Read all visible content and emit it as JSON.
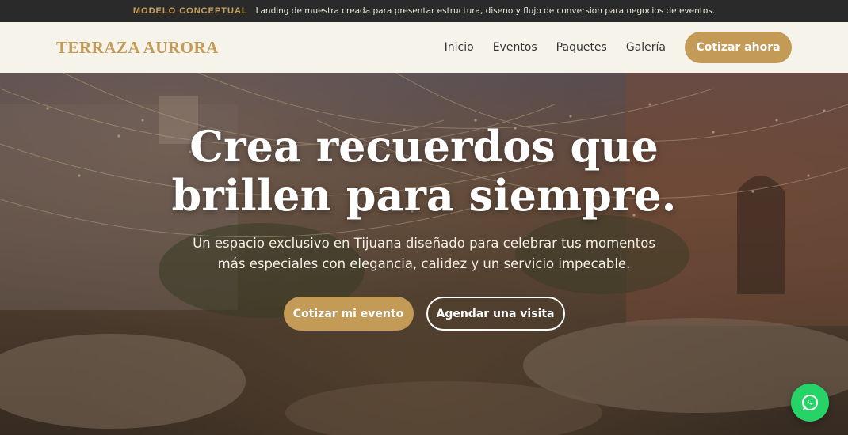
{
  "topbar": {
    "tag": "MODELO CONCEPTUAL",
    "message": "Landing de muestra creada para presentar estructura, diseno y flujo de conversion para negocios de eventos."
  },
  "header": {
    "logo": "TERRAZA AURORA",
    "nav": [
      "Inicio",
      "Eventos",
      "Paquetes",
      "Galería"
    ],
    "cta": "Cotizar ahora"
  },
  "hero": {
    "title_line1": "Crea recuerdos que",
    "title_line2": "brillen para siempre.",
    "subtitle": "Un espacio exclusivo en Tijuana diseñado para celebrar tus momentos más especiales con elegancia, calidez y un servicio impecable.",
    "primary_button": "Cotizar mi evento",
    "secondary_button": "Agendar una visita"
  },
  "floating": {
    "icon": "whatsapp-icon"
  },
  "colors": {
    "accent": "#c49a57",
    "topbar_bg": "#2a2a2a",
    "header_bg": "#f6f3ea",
    "whatsapp": "#25d366"
  }
}
